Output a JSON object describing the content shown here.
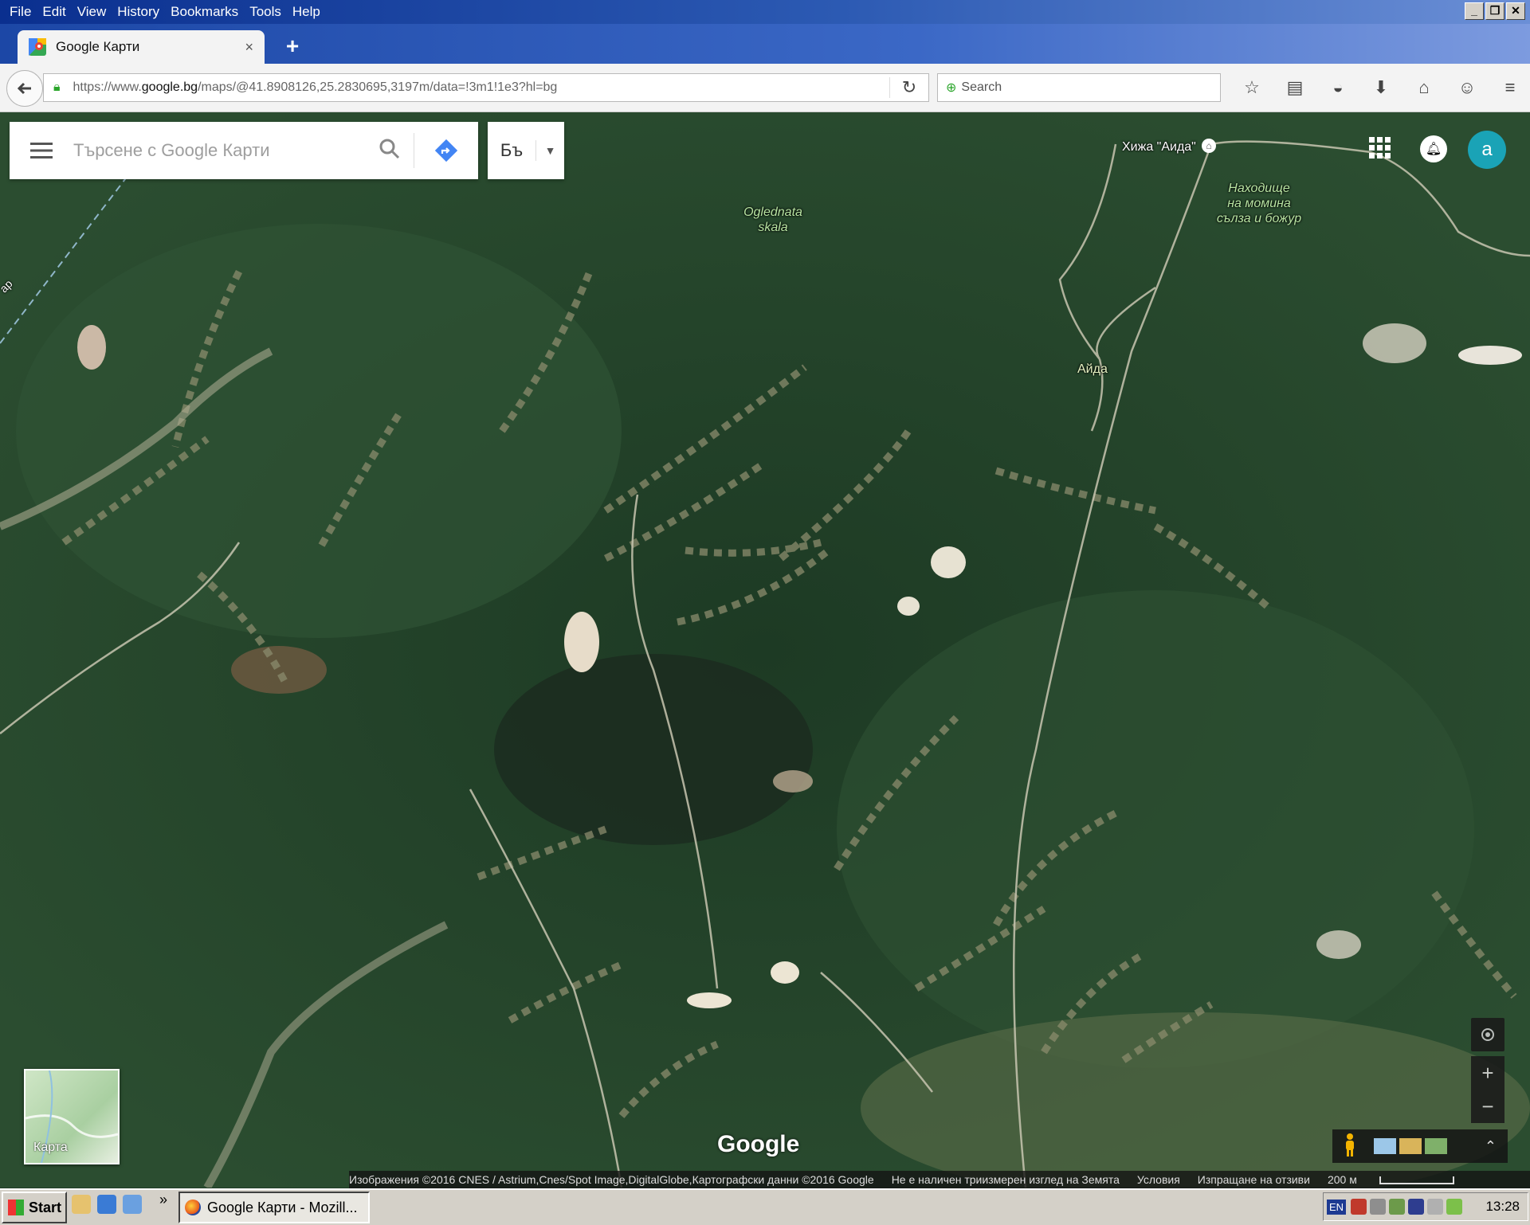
{
  "menu": [
    "File",
    "Edit",
    "View",
    "History",
    "Bookmarks",
    "Tools",
    "Help"
  ],
  "window_controls": [
    "_",
    "❐",
    "✕"
  ],
  "tab": {
    "title": "Google Карти",
    "close": "×",
    "new_tab": "+"
  },
  "address": {
    "prefix": "https://www.",
    "domain": "google.bg",
    "path": "/maps/@41.8908126,25.2830695,3197m/data=!3m1!1e3?hl=bg"
  },
  "browser_search": {
    "placeholder": "Search"
  },
  "maps": {
    "search_placeholder": "Търсене с Google Карти",
    "lang": "Бъ",
    "avatar_letter": "a",
    "labels": {
      "hut": "Хижа \"Аида\"",
      "ogled1": "Oglednata",
      "ogled2": "skala",
      "find1": "Находище",
      "find2": "на момина",
      "find3": "сълза и божур",
      "aida": "Айда",
      "road": "ар"
    },
    "thumbnail_label": "Карта",
    "google": "Google",
    "attribution": "Изображения ©2016 CNES / Astrium,Cnes/Spot Image,DigitalGlobe,Картографски данни ©2016 Google",
    "no3d": "Не е наличен триизмерен изглед на Земята",
    "terms": "Условия",
    "feedback": "Изпращане на отзиви",
    "scale": "200 м"
  },
  "taskbar": {
    "start": "Start",
    "task": "Google Карти - Mozill...",
    "lang": "EN",
    "clock": "13:28",
    "chevron": "»"
  },
  "colors": {
    "titlebar": "#0a2f8f",
    "forest": "#26452c",
    "avatar": "#1aa3b6",
    "directions": "#4285f4"
  }
}
